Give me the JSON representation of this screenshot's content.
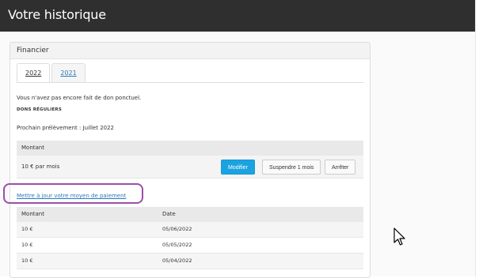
{
  "header": {
    "title": "Votre historique"
  },
  "panel": {
    "title": "Financier",
    "tabs": [
      {
        "label": "2022",
        "active": true
      },
      {
        "label": "2021",
        "active": false
      }
    ],
    "no_donation_text": "Vous n'avez pas encore fait de don ponctuel.",
    "recurring_heading": "DONS RÉGULIERS",
    "next_debit_text": "Prochain prélèvement : Juillet 2022",
    "recurring_table": {
      "header": "Montant",
      "row": {
        "amount": "10 € par mois",
        "modify_label": "Modifier",
        "suspend_label": "Suspendre 1 mois",
        "stop_label": "Arrêter"
      }
    },
    "update_payment_link": "Mettre à jour votre moyen de paiement",
    "history_table": {
      "headers": [
        "Montant",
        "Date"
      ],
      "rows": [
        {
          "amount": "10 €",
          "date": "05/06/2022"
        },
        {
          "amount": "10 €",
          "date": "05/05/2022"
        },
        {
          "amount": "10 €",
          "date": "05/04/2022"
        }
      ]
    }
  },
  "colors": {
    "topbar": "#2f2f2f",
    "primary_button": "#1aa3e0",
    "link": "#2a7ab8",
    "highlight": "#9b4fa8"
  },
  "icons": {
    "cursor": "mouse-pointer-icon"
  }
}
